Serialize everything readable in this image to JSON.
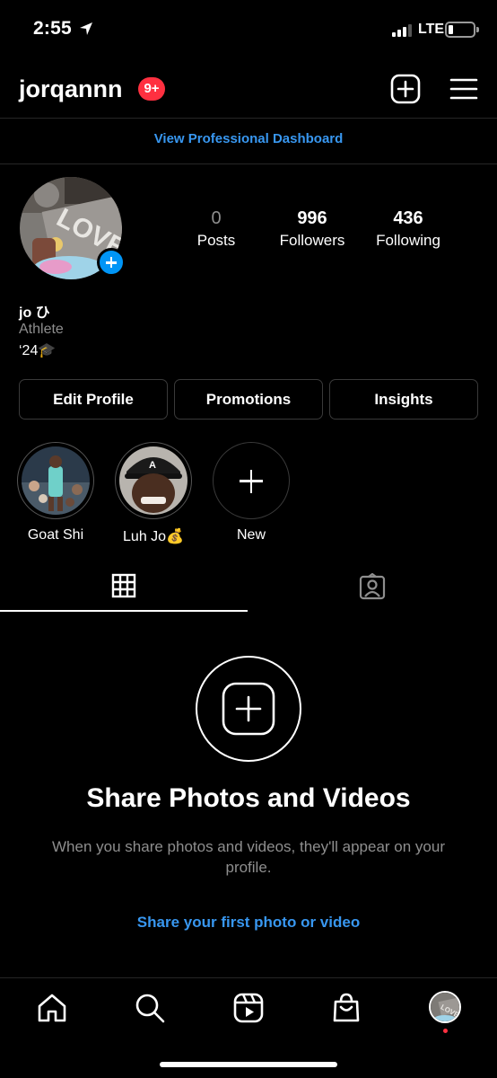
{
  "status_bar": {
    "time": "2:55",
    "network": "LTE"
  },
  "header": {
    "username": "jorqannn",
    "notification_badge": "9+"
  },
  "professional_dashboard_link": "View Professional Dashboard",
  "stats": [
    {
      "value": "0",
      "label": "Posts"
    },
    {
      "value": "996",
      "label": "Followers"
    },
    {
      "value": "436",
      "label": "Following"
    }
  ],
  "bio": {
    "name": "jo ひ",
    "category": "Athlete",
    "text": "‘24🎓"
  },
  "buttons": {
    "edit_profile": "Edit Profile",
    "promotions": "Promotions",
    "insights": "Insights"
  },
  "highlights": [
    {
      "label": "Goat Shi"
    },
    {
      "label": "Luh Jo💰"
    },
    {
      "label": "New"
    }
  ],
  "tabs": {
    "active": "grid"
  },
  "empty_state": {
    "title": "Share Photos and Videos",
    "subtitle": "When you share photos and videos, they'll appear on your profile.",
    "link": "Share your first photo or video"
  },
  "colors": {
    "link_blue": "#3897f0",
    "badge_red": "#ff3040",
    "background": "#000000",
    "muted": "#8e8e8e"
  }
}
